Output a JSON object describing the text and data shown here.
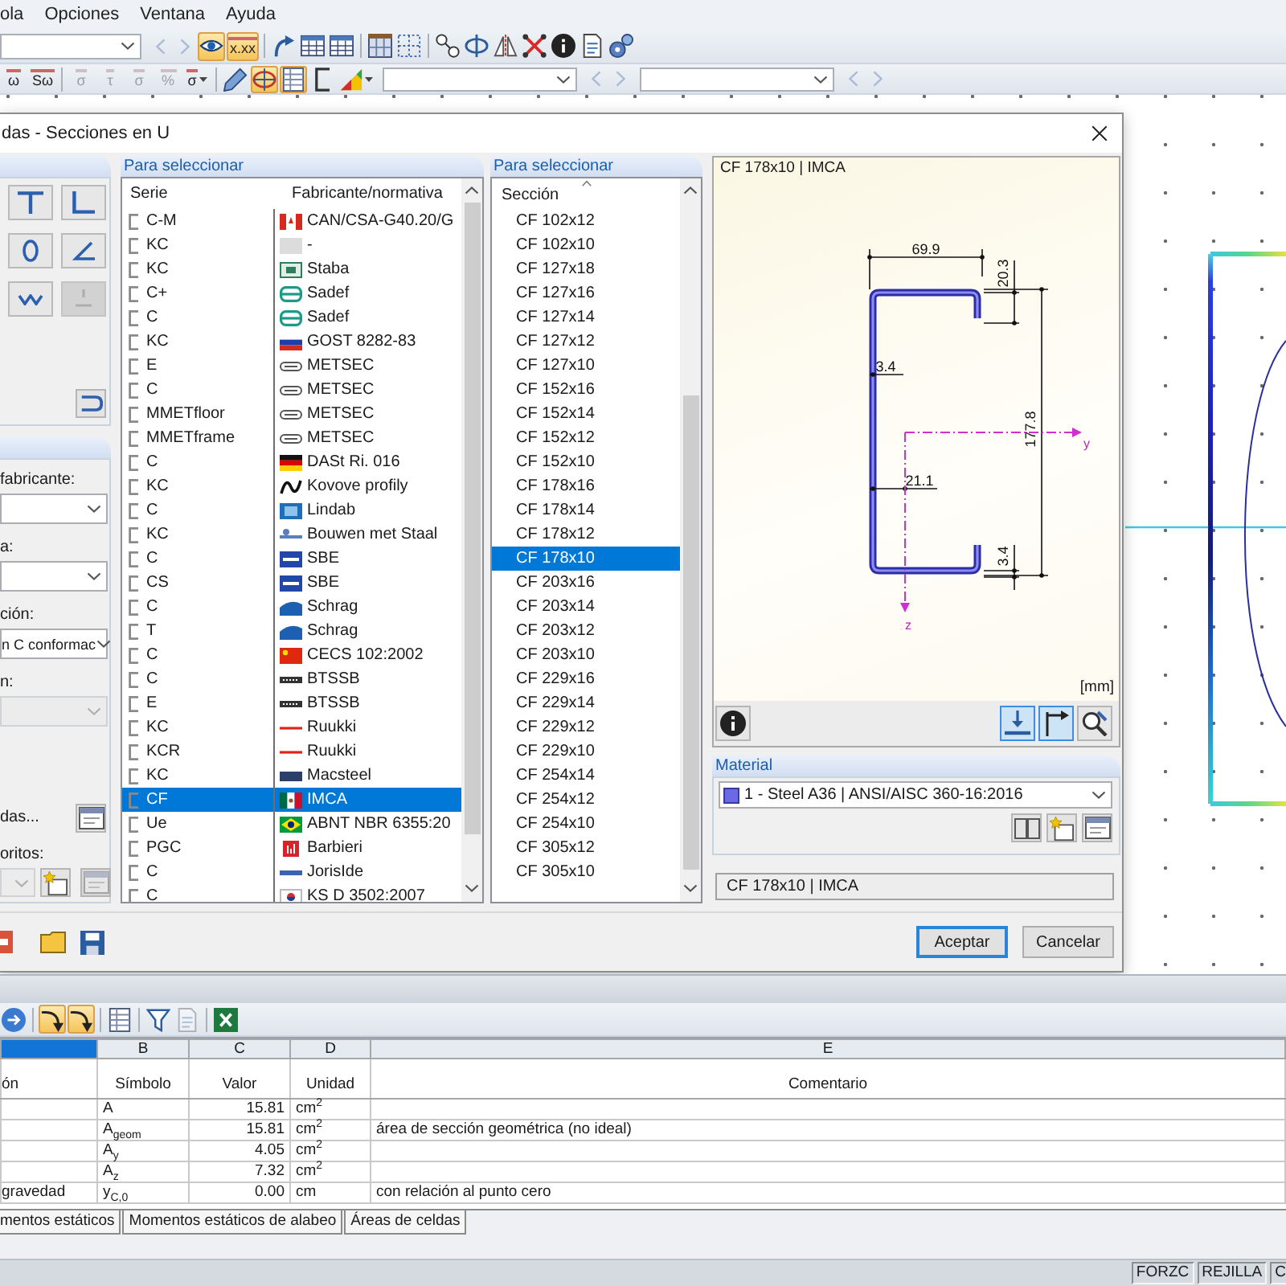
{
  "menu_bar": {
    "items": [
      "ola",
      "Opciones",
      "Ventana",
      "Ayuda"
    ]
  },
  "toolbar_1": [
    {
      "kind": "combo"
    },
    {
      "kind": "prev",
      "disabled": true
    },
    {
      "kind": "next",
      "disabled": true
    },
    {
      "kind": "tool",
      "on": true,
      "disabled": false
    },
    {
      "kind": "tool",
      "on": true,
      "disabled": false,
      "label": "x.xx"
    },
    {
      "kind": "separator"
    },
    {
      "kind": "tool",
      "on": false,
      "disabled": false
    },
    {
      "kind": "tool",
      "on": false,
      "disabled": false
    },
    {
      "kind": "tool",
      "on": false,
      "disabled": false
    },
    {
      "kind": "separator"
    },
    {
      "kind": "tool",
      "on": false,
      "disabled": false
    },
    {
      "kind": "tool",
      "on": false,
      "disabled": false
    },
    {
      "kind": "separator"
    },
    {
      "kind": "tool",
      "on": false,
      "disabled": false
    },
    {
      "kind": "tool",
      "on": false,
      "disabled": false
    },
    {
      "kind": "tool",
      "on": false,
      "disabled": false
    },
    {
      "kind": "tool",
      "on": false,
      "disabled": false
    },
    {
      "kind": "tool",
      "on": false,
      "disabled": false
    },
    {
      "kind": "tool",
      "on": false,
      "disabled": false
    },
    {
      "kind": "tool",
      "on": false,
      "disabled": false
    }
  ],
  "toolbar_2": [
    {
      "kind": "tool",
      "on": false,
      "disabled": false,
      "label": "ω"
    },
    {
      "kind": "tool",
      "on": false,
      "disabled": false,
      "label": "Sω"
    },
    {
      "kind": "separator"
    },
    {
      "kind": "tool",
      "on": false,
      "disabled": true,
      "label": "σ"
    },
    {
      "kind": "tool",
      "on": false,
      "disabled": true,
      "label": "τ"
    },
    {
      "kind": "tool",
      "on": false,
      "disabled": true,
      "label": "σ"
    },
    {
      "kind": "tool",
      "on": false,
      "disabled": true,
      "label": "%"
    },
    {
      "kind": "menu-tool",
      "on": false,
      "disabled": false,
      "label": "σ"
    },
    {
      "kind": "separator"
    },
    {
      "kind": "tool",
      "on": false,
      "disabled": false
    },
    {
      "kind": "tool",
      "on": true,
      "disabled": false
    },
    {
      "kind": "tool",
      "on": true,
      "disabled": false
    },
    {
      "kind": "tool",
      "on": false,
      "disabled": false
    },
    {
      "kind": "menu-tool",
      "on": false,
      "disabled": false
    },
    {
      "kind": "combo"
    },
    {
      "kind": "prev",
      "disabled": true
    },
    {
      "kind": "next",
      "disabled": true
    },
    {
      "kind": "combo"
    },
    {
      "kind": "prev",
      "disabled": true
    },
    {
      "kind": "next",
      "disabled": true
    }
  ],
  "dialog": {
    "title": "das - Secciones en U",
    "shape_buttons": [
      {
        "disabled": false
      },
      {
        "disabled": false
      },
      {
        "disabled": false
      },
      {
        "disabled": false
      },
      {
        "disabled": false
      },
      {
        "disabled": true
      }
    ],
    "filters": [
      {
        "label": "fabricante:",
        "disabled": false
      },
      {
        "label": "a:",
        "disabled": false
      },
      {
        "label": "ción:",
        "value": "n C conformac",
        "disabled": false
      },
      {
        "label": "n:",
        "disabled": true
      }
    ],
    "more_label": "das...",
    "favorites": {
      "label": "oritos:",
      "disabled": true
    },
    "series_list": {
      "header": "Para seleccionar",
      "columns": [
        "Serie",
        "Fabricante/normativa"
      ],
      "rows": [
        {
          "serie": "C-M",
          "maker": "CAN/CSA-G40.20/G",
          "selected": false
        },
        {
          "serie": "KC",
          "maker": "-",
          "selected": false
        },
        {
          "serie": "KC",
          "maker": "Staba",
          "selected": false
        },
        {
          "serie": "C+",
          "maker": "Sadef",
          "selected": false
        },
        {
          "serie": "C",
          "maker": "Sadef",
          "selected": false
        },
        {
          "serie": "KC",
          "maker": "GOST 8282-83",
          "selected": false
        },
        {
          "serie": "E",
          "maker": "METSEC",
          "selected": false
        },
        {
          "serie": "C",
          "maker": "METSEC",
          "selected": false
        },
        {
          "serie": "MMETfloor",
          "maker": "METSEC",
          "selected": false
        },
        {
          "serie": "MMETframe",
          "maker": "METSEC",
          "selected": false
        },
        {
          "serie": "C",
          "maker": "DASt Ri. 016",
          "selected": false
        },
        {
          "serie": "KC",
          "maker": "Kovove profily",
          "selected": false
        },
        {
          "serie": "C",
          "maker": "Lindab",
          "selected": false
        },
        {
          "serie": "KC",
          "maker": "Bouwen met Staal",
          "selected": false
        },
        {
          "serie": "C",
          "maker": "SBE",
          "selected": false
        },
        {
          "serie": "CS",
          "maker": "SBE",
          "selected": false
        },
        {
          "serie": "C",
          "maker": "Schrag",
          "selected": false
        },
        {
          "serie": "T",
          "maker": "Schrag",
          "selected": false
        },
        {
          "serie": "C",
          "maker": "CECS 102:2002",
          "selected": false
        },
        {
          "serie": "C",
          "maker": "BTSSB",
          "selected": false
        },
        {
          "serie": "E",
          "maker": "BTSSB",
          "selected": false
        },
        {
          "serie": "KC",
          "maker": "Ruukki",
          "selected": false
        },
        {
          "serie": "KCR",
          "maker": "Ruukki",
          "selected": false
        },
        {
          "serie": "KC",
          "maker": "Macsteel",
          "selected": false
        },
        {
          "serie": "CF",
          "maker": "IMCA",
          "selected": true
        },
        {
          "serie": "Ue",
          "maker": "ABNT NBR 6355:20",
          "selected": false
        },
        {
          "serie": "PGC",
          "maker": "Barbieri",
          "selected": false
        },
        {
          "serie": "C",
          "maker": "JorisIde",
          "selected": false
        },
        {
          "serie": "C",
          "maker": "KS D 3502:2007",
          "selected": false
        }
      ]
    },
    "section_list": {
      "header": "Para seleccionar",
      "column": "Sección",
      "rows": [
        {
          "name": "CF 102x12",
          "selected": false
        },
        {
          "name": "CF 102x10",
          "selected": false
        },
        {
          "name": "CF 127x18",
          "selected": false
        },
        {
          "name": "CF 127x16",
          "selected": false
        },
        {
          "name": "CF 127x14",
          "selected": false
        },
        {
          "name": "CF 127x12",
          "selected": false
        },
        {
          "name": "CF 127x10",
          "selected": false
        },
        {
          "name": "CF 152x16",
          "selected": false
        },
        {
          "name": "CF 152x14",
          "selected": false
        },
        {
          "name": "CF 152x12",
          "selected": false
        },
        {
          "name": "CF 152x10",
          "selected": false
        },
        {
          "name": "CF 178x16",
          "selected": false
        },
        {
          "name": "CF 178x14",
          "selected": false
        },
        {
          "name": "CF 178x12",
          "selected": false
        },
        {
          "name": "CF 178x10",
          "selected": true
        },
        {
          "name": "CF 203x16",
          "selected": false
        },
        {
          "name": "CF 203x14",
          "selected": false
        },
        {
          "name": "CF 203x12",
          "selected": false
        },
        {
          "name": "CF 203x10",
          "selected": false
        },
        {
          "name": "CF 229x16",
          "selected": false
        },
        {
          "name": "CF 229x14",
          "selected": false
        },
        {
          "name": "CF 229x12",
          "selected": false
        },
        {
          "name": "CF 229x10",
          "selected": false
        },
        {
          "name": "CF 254x14",
          "selected": false
        },
        {
          "name": "CF 254x12",
          "selected": false
        },
        {
          "name": "CF 254x10",
          "selected": false
        },
        {
          "name": "CF 305x12",
          "selected": false
        },
        {
          "name": "CF 305x10",
          "selected": false
        }
      ]
    },
    "preview": {
      "title": "CF 178x10 | IMCA",
      "dimension_labels": [
        "69.9",
        "20.3",
        "3.4",
        "177.8",
        "21.1",
        "3.4"
      ],
      "axis_labels": [
        "y",
        "z"
      ],
      "unit": "[mm]",
      "tools": [
        {
          "on": false
        },
        {
          "on": true
        },
        {
          "on": true
        },
        {
          "on": false
        }
      ]
    },
    "material": {
      "header": "Material",
      "value": "1 - Steel A36 | ANSI/AISC 360-16:2016"
    },
    "section_field": {
      "value": "CF 178x10 | IMCA"
    },
    "buttons": [
      {
        "label": "Aceptar",
        "default": true
      },
      {
        "label": "Cancelar",
        "default": false
      }
    ]
  },
  "toolbar_3": [
    {
      "kind": "tool",
      "on": false,
      "disabled": false
    },
    {
      "kind": "separator"
    },
    {
      "kind": "tool",
      "on": true,
      "disabled": false
    },
    {
      "kind": "tool",
      "on": true,
      "disabled": false
    },
    {
      "kind": "separator"
    },
    {
      "kind": "tool",
      "on": false,
      "disabled": false
    },
    {
      "kind": "separator"
    },
    {
      "kind": "tool",
      "on": false,
      "disabled": false
    },
    {
      "kind": "tool",
      "on": false,
      "disabled": true
    },
    {
      "kind": "separator"
    },
    {
      "kind": "tool",
      "on": false,
      "disabled": false
    }
  ],
  "table": {
    "columns": [
      {
        "selected": true
      },
      {
        "letter": "B",
        "selected": false
      },
      {
        "letter": "C",
        "selected": false
      },
      {
        "letter": "D",
        "selected": false
      },
      {
        "letter": "E",
        "selected": false
      }
    ],
    "headers": [
      "ón",
      "Símbolo",
      "Valor",
      "Unidad",
      "Comentario"
    ],
    "rows": [
      {
        "symbol": "A",
        "value": "15.81",
        "unit": "cm$^{2}$"
      },
      {
        "symbol": "A$_{geom}$",
        "value": "15.81",
        "unit": "cm$^{2}$",
        "comment": "área de sección geométrica (no ideal)"
      },
      {
        "symbol": "A$_{y}$",
        "value": "4.05",
        "unit": "cm$^{2}$"
      },
      {
        "symbol": "A$_{z}$",
        "value": "7.32",
        "unit": "cm$^{2}$"
      },
      {
        "column_a": "gravedad",
        "symbol": "y$_{C,0}$",
        "value": "0.00",
        "unit": "cm",
        "comment": "con relación al punto cero"
      }
    ]
  },
  "sheet_tabs": [
    {
      "label": "mentos estáticos",
      "selected": false
    },
    {
      "label": "Momentos estáticos de alabeo",
      "selected": false
    },
    {
      "label": "Áreas de celdas",
      "selected": false
    }
  ],
  "status_bar": {
    "fields": [
      "FORZC",
      "REJILLA",
      "C"
    ]
  }
}
